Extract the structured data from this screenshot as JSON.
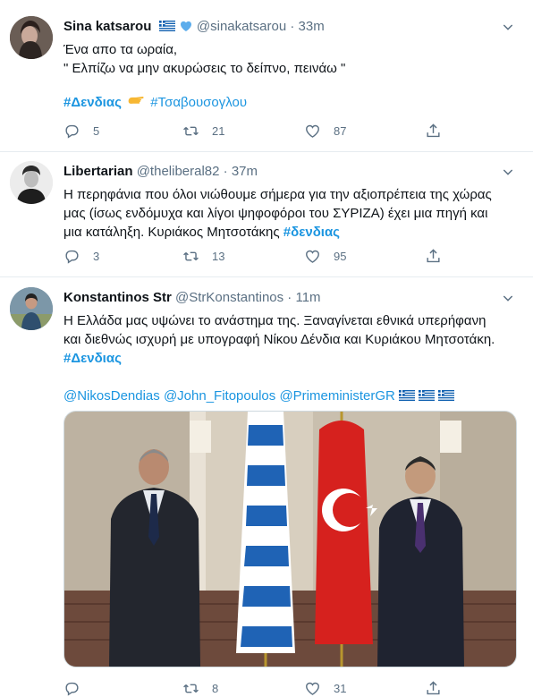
{
  "tweets": [
    {
      "name": "Sina katsarou",
      "handle": "@sinakatsarou",
      "time": "33m",
      "line1": "Ένα απο τα ωραία,",
      "line2": "\" Ελπίζω να μην ακυρώσεις το δείπνο, πεινάω \"",
      "tag1": "#Δενδιας",
      "emoji": "pointing-hand-icon",
      "tag2": "#Τσαβουσογλου",
      "replies": "5",
      "retweets": "21",
      "likes": "87"
    },
    {
      "name": "Libertarian",
      "handle": "@theliberal82",
      "time": "37m",
      "line1": "Η περηφάνια που όλοι νιώθουμε σήμερα για την αξιοπρέπεια της χώρας",
      "line2": "μας (ίσως ενδόμυχα και λίγοι ψηφοφόροι του ΣΥΡΙΖΑ) έχει μια πηγή και",
      "line3": "μια κατάληξη. Κυριάκος Μητσοτάκης",
      "tag1": "#δενδιας",
      "replies": "3",
      "retweets": "13",
      "likes": "95"
    },
    {
      "name": "Konstantinos Str",
      "handle": "@StrKonstantinos",
      "time": "11m",
      "line1": "Η Ελλάδα μας υψώνει το ανάστημα της. Ξαναγίνεται εθνικά υπερήφανη",
      "line2": "και διεθνώς ισχυρή με υπογραφή Νίκου Δένδια και Κυριάκου Μητσοτάκη.",
      "tag1": "#Δενδιας",
      "mention1": "@NikosDendias",
      "mention2": "@John_Fitopoulos",
      "mention3": "@PrimeministerGR",
      "retweets": "8",
      "likes": "31"
    }
  ],
  "separator": " · ",
  "colors": {
    "link": "#1b95e0",
    "muted": "#5b7083",
    "divider": "#e6ecf0",
    "verified": "#1da1f2"
  }
}
